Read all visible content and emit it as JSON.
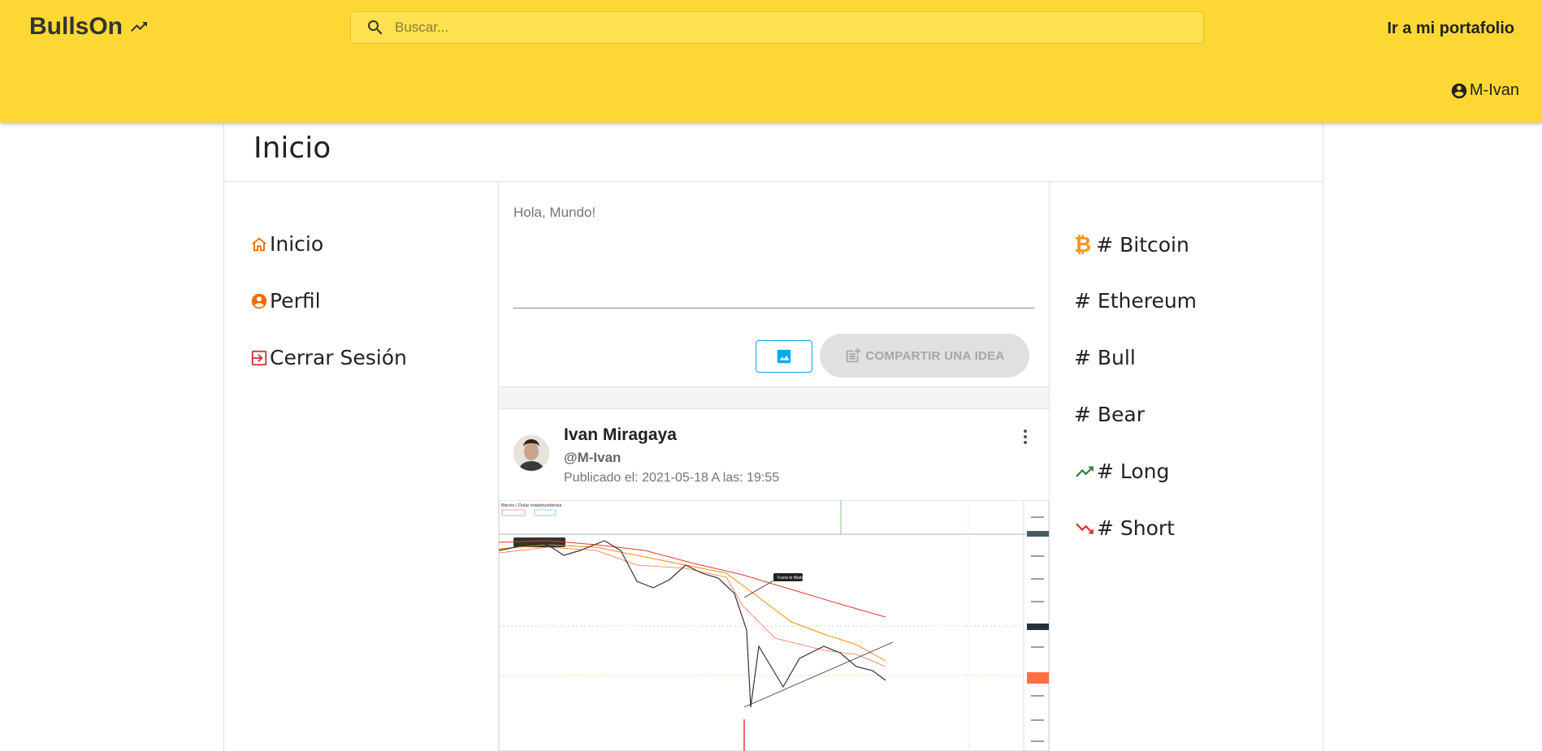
{
  "header": {
    "logo_text": "BullsOn",
    "search_placeholder": "Buscar...",
    "portfolio_link": "Ir a mi portafolio",
    "user_link": "M-Ivan"
  },
  "page": {
    "title": "Inicio"
  },
  "leftnav": {
    "items": [
      {
        "label": "Inicio",
        "icon": "home-icon",
        "color": "#ef6c00"
      },
      {
        "label": "Perfil",
        "icon": "account-circle-icon",
        "color": "#ef6c00"
      },
      {
        "label": "Cerrar Sesión",
        "icon": "exit-icon",
        "color": "#d32f2f"
      }
    ]
  },
  "composer": {
    "text": "Hola, Mundo!",
    "share_label": "COMPARTIR UNA IDEA"
  },
  "post": {
    "author": "Ivan Miragaya",
    "handle": "@M-Ivan",
    "date": "Publicado el: 2021-05-18 A las: 19:55",
    "image_caption": "Bitcoin / Dolar estadounidense",
    "image_annotation": "Fuera in Muda"
  },
  "tags": {
    "items": [
      {
        "label": "# Bitcoin",
        "icon": "bitcoin-icon",
        "color": "#f7931a"
      },
      {
        "label": "# Ethereum",
        "icon": "",
        "color": ""
      },
      {
        "label": "# Bull",
        "icon": "",
        "color": ""
      },
      {
        "label": "# Bear",
        "icon": "",
        "color": ""
      },
      {
        "label": "# Long",
        "icon": "trending-up-icon",
        "color": "#2e7d32"
      },
      {
        "label": "# Short",
        "icon": "trending-down-icon",
        "color": "#d32f2f"
      }
    ]
  },
  "colors": {
    "appbar": "#fdd835",
    "accent": "#03a9f4"
  }
}
